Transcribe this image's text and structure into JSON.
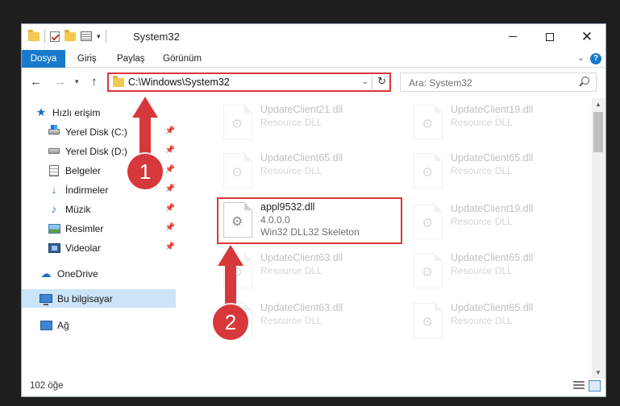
{
  "window": {
    "title": "System32"
  },
  "ribbon": {
    "tabs": [
      "Dosya",
      "Giriş",
      "Paylaş",
      "Görünüm"
    ]
  },
  "address": {
    "path": "C:\\Windows\\System32",
    "search_placeholder": "Ara: System32"
  },
  "nav_pane": {
    "quick_access": "Hızlı erişim",
    "items": [
      {
        "label": "Yerel Disk (C:)",
        "icon": "drive-c-icon",
        "pinned": true
      },
      {
        "label": "Yerel Disk (D:)",
        "icon": "drive-icon",
        "pinned": true
      },
      {
        "label": "Belgeler",
        "icon": "documents-icon",
        "pinned": true
      },
      {
        "label": "İndirmeler",
        "icon": "downloads-icon",
        "pinned": true
      },
      {
        "label": "Müzik",
        "icon": "music-icon",
        "pinned": true
      },
      {
        "label": "Resimler",
        "icon": "pictures-icon",
        "pinned": true
      },
      {
        "label": "Videolar",
        "icon": "videos-icon",
        "pinned": true
      }
    ],
    "onedrive": "OneDrive",
    "this_pc": "Bu bilgisayar",
    "network": "Ağ"
  },
  "files": {
    "left": [
      {
        "name": "UpdateClient21.dll",
        "desc": "Resource DLL",
        "faded": true
      },
      {
        "name": "UpdateClient65.dll",
        "desc": "Resource DLL",
        "faded": true
      },
      {
        "name": "appl9532.dll",
        "version": "4.0.0.0",
        "desc": "Win32 DLL32 Skeleton",
        "faded": false,
        "highlighted": true
      },
      {
        "name": "UpdateClient63.dll",
        "desc": "Resource DLL",
        "faded": true
      },
      {
        "name": "UpdateClient63.dll",
        "desc": "Resource DLL",
        "faded": true
      }
    ],
    "right": [
      {
        "name": "UpdateClient19.dll",
        "desc": "Resource DLL",
        "faded": true
      },
      {
        "name": "UpdateClient65.dll",
        "desc": "Resource DLL",
        "faded": true
      },
      {
        "name": "UpdateClient19.dll",
        "desc": "Resource DLL",
        "faded": true
      },
      {
        "name": "UpdateClient65.dll",
        "desc": "Resource DLL",
        "faded": true
      },
      {
        "name": "UpdateClient65.dll",
        "desc": "Resource DLL",
        "faded": true
      }
    ]
  },
  "status": {
    "item_count": "102 öğe"
  },
  "annotations": {
    "step1": "1",
    "step2": "2"
  },
  "colors": {
    "accent": "#1979ca",
    "highlight_red": "#d9373b",
    "selection": "#cce4f7"
  }
}
